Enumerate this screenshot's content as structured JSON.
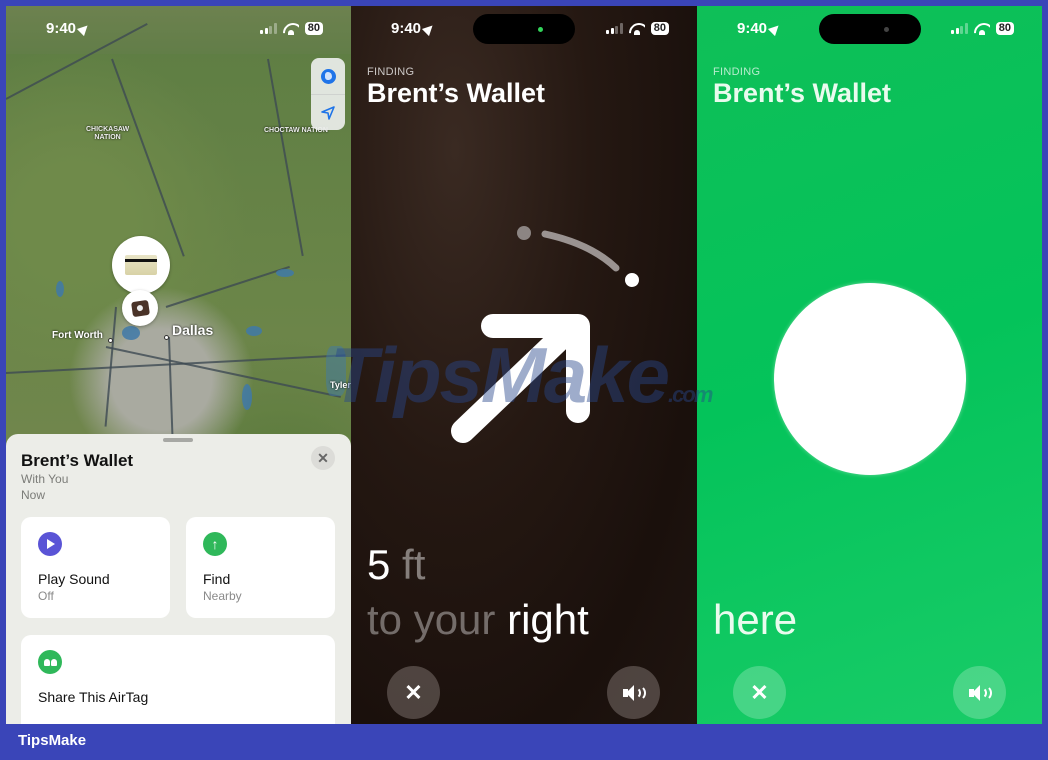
{
  "status_bar": {
    "time": "9:40",
    "battery": "80"
  },
  "map_screen": {
    "map_labels": {
      "region_1": "CHICKASAW\nNATION",
      "region_2": "CHOCTAW NATION",
      "city_1": "Fort Worth",
      "city_2": "Dallas",
      "city_3": "Tyler"
    },
    "map_controls": [
      "globe-icon",
      "location-arrow-icon"
    ],
    "item_sheet": {
      "title": "Brent’s Wallet",
      "subtitle": "With You",
      "time": "Now",
      "actions": [
        {
          "label": "Play Sound",
          "sublabel": "Off",
          "icon": "play-icon",
          "color": "#5a54d6"
        },
        {
          "label": "Find",
          "sublabel": "Nearby",
          "icon": "arrow-up-icon",
          "color": "#2fb85a"
        },
        {
          "label": "Share This AirTag",
          "sublabel": "",
          "icon": "people-icon",
          "color": "#2fb85a"
        }
      ]
    }
  },
  "finding_screen": {
    "label": "FINDING",
    "title": "Brent’s Wallet",
    "distance_value": "5",
    "distance_unit": "ft",
    "direction_prefix": "to your",
    "direction": "right",
    "bg_color": "#1f140f"
  },
  "found_screen": {
    "label": "FINDING",
    "title": "Brent’s Wallet",
    "status": "here",
    "bg_color": "#07c25a"
  },
  "watermark": {
    "text": "TipsMake",
    "suffix": ".com"
  },
  "footer": {
    "brand": "TipsMake"
  }
}
